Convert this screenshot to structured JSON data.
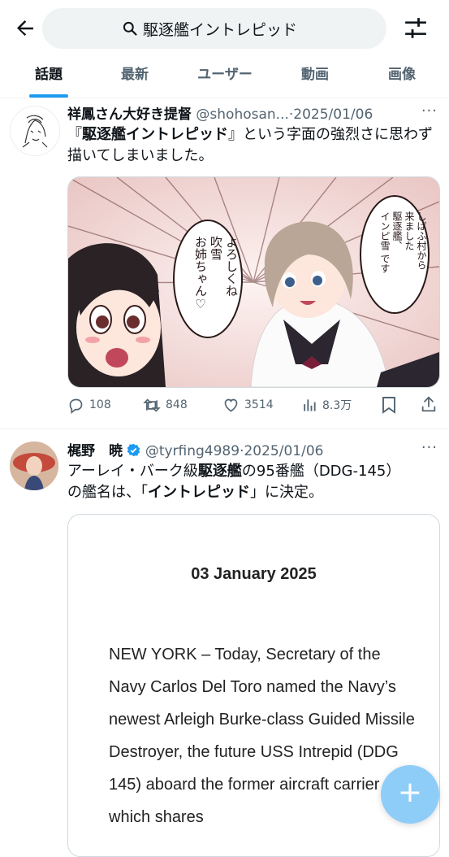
{
  "search": {
    "value": "駆逐艦イントレピッド"
  },
  "tabs": [
    {
      "label": "話題",
      "active": true
    },
    {
      "label": "最新"
    },
    {
      "label": "ユーザー"
    },
    {
      "label": "動画"
    },
    {
      "label": "画像"
    }
  ],
  "tweets": [
    {
      "name": "祥鳳さん大好き提督",
      "handle": "@shohosan...",
      "sep": "·",
      "date": "2025/01/06",
      "text_part1": "『",
      "text_bold": "駆逐艦イントレピッド",
      "text_part2": "』という字面の強烈さに思わず描いてしまいました。",
      "image": {
        "bubble_left": [
          "よろしくね",
          "吹雪",
          "お姉ちゃん♡"
        ],
        "bubble_right": [
          "しばふ村から",
          "来ました",
          "駆逐艦、",
          "インピ雪 です"
        ]
      },
      "stats": {
        "replies": "108",
        "retweets": "848",
        "likes": "3514",
        "views": "8.3万"
      }
    },
    {
      "name": "梶野　暁",
      "handle": "@tyrfing4989",
      "sep": "·",
      "date": "2025/01/06",
      "line1_a": "アーレイ・バーク級",
      "line1_b": "駆逐艦",
      "line1_c": "の95番艦（DDG-145）",
      "line2_a": "の艦名は、「",
      "line2_b": "イントレピッド",
      "line2_c": "」に決定。",
      "card": {
        "date": "03 January 2025",
        "body": "NEW YORK – Today, Secretary of the Navy Carlos Del Toro named the Navy’s newest Arleigh Burke-class Guided Missile Destroyer, the future USS Intrepid (DDG 145) aboard the former aircraft carrier which shares"
      }
    }
  ],
  "colors": {
    "accent": "#1d9bf0",
    "verified": "#1d9bf0",
    "fab": "#8ecdf8"
  },
  "fab": {
    "label": "+"
  }
}
